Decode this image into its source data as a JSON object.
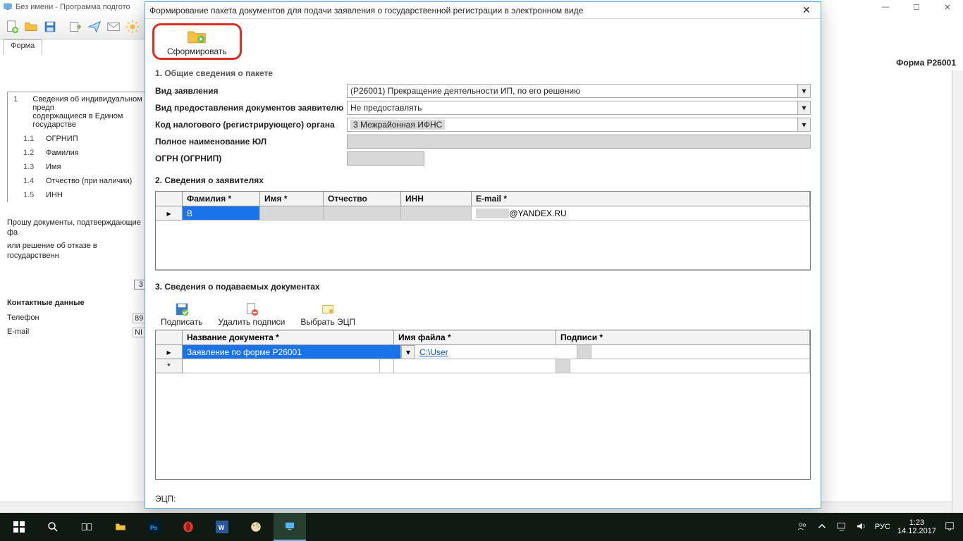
{
  "app": {
    "title": "Без имени - Программа подгото"
  },
  "tabs": {
    "form": "Форма"
  },
  "form_label": "Форма Р26001",
  "bg": {
    "section1_num": "1",
    "section1_text1": "Сведения об индивидуальном предп",
    "section1_text2": "содержащиеся в Едином государстве",
    "r11_num": "1.1",
    "r11": "ОГРНИП",
    "r12_num": "1.2",
    "r12": "Фамилия",
    "r13_num": "1.3",
    "r13": "Имя",
    "r14_num": "1.4",
    "r14": "Отчество (при наличии)",
    "r15_num": "1.5",
    "r15": "ИНН",
    "ask1": "Прошу документы, подтверждающие фа",
    "ask2": "или решение об отказе в государственн",
    "ask_val": "3",
    "contacts_title": "Контактные данные",
    "tel_label": "Телефон",
    "tel_val": "89",
    "email_label": "E-mail",
    "email_val": "NI"
  },
  "modal": {
    "title": "Формирование пакета документов для подачи заявления о государственной регистрации в электронном виде",
    "generate": "Сформировать",
    "s1_title": "1. Общие сведения о пакете",
    "f_vid_label": "Вид заявления",
    "f_vid_value": "(Р26001) Прекращение деятельности ИП, по его решению",
    "f_pred_label": "Вид предоставления документов заявителю",
    "f_pred_value": "Не предоставлять",
    "f_code_label": "Код налогового (регистрирующего) органа",
    "f_code_value": "3       Межрайонная ИФНС",
    "f_full_label": "Полное наименование ЮЛ",
    "f_full_value": "",
    "f_ogrn_label": "ОГРН (ОГРНИП)",
    "f_ogrn_value": "",
    "s2_title": "2. Сведения о заявителях",
    "gh_fam": "Фамилия *",
    "gh_name": "Имя *",
    "gh_otch": "Отчество",
    "gh_inn": "ИНН",
    "gh_email": "E-mail *",
    "row_fam": "В",
    "row_name": "",
    "row_otch": "",
    "row_inn": "",
    "row_email": "@YANDEX.RU",
    "s3_title": "3.  Сведения о подаваемых документах",
    "btn_sign": "Подписать",
    "btn_delsign": "Удалить подписи",
    "btn_pick": "Выбрать ЭЦП",
    "dh_name": "Название документа *",
    "dh_file": "Имя файла *",
    "dh_sign": "Подписи *",
    "doc_name": "Заявление по форме Р26001",
    "doc_file": "C:\\User",
    "star_row": "*",
    "ecp_label": "ЭЦП:"
  },
  "taskbar": {
    "lang": "РУС",
    "time": "1:23",
    "date": "14.12.2017"
  }
}
